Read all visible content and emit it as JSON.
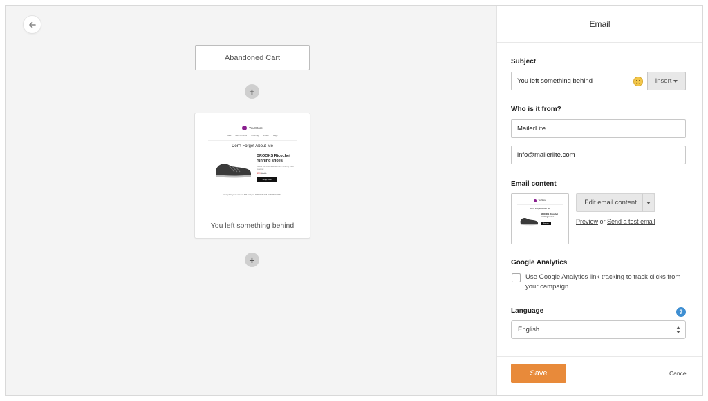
{
  "canvas": {
    "trigger_label": "Abandoned Cart",
    "email_card_label": "You left something behind",
    "preview": {
      "brand": "YourStore",
      "nav": [
        "Sale",
        "New Arrivals",
        "Clothing",
        "Shoes",
        "Bags"
      ],
      "heading": "Don't Forget About Me",
      "product_name": "BROOKS Ricochet running shoes",
      "product_desc": "Defeat the odds and Get OFF running shoe together.",
      "price_new": "$59",
      "price_old": "$110",
      "cta": "Shop now",
      "footer": "Complete your order in 48h and you 15% OFF YOUR PURCHASE!"
    }
  },
  "panel": {
    "title": "Email",
    "subject": {
      "label": "Subject",
      "value": "You left something behind",
      "insert_label": "Insert"
    },
    "from": {
      "label": "Who is it from?",
      "name_value": "MailerLite",
      "email_value": "info@mailerlite.com"
    },
    "content": {
      "label": "Email content",
      "edit_label": "Edit email content",
      "preview_link": "Preview",
      "or_text": " or ",
      "test_link": "Send a test email"
    },
    "analytics": {
      "label": "Google Analytics",
      "checkbox_text": "Use Google Analytics link tracking to track clicks from your campaign.",
      "checked": false
    },
    "language": {
      "label": "Language",
      "value": "English",
      "help": "?"
    },
    "save_label": "Save",
    "cancel_label": "Cancel"
  },
  "colors": {
    "accent": "#e88a3a",
    "help": "#3f8fd2",
    "brand_logo": "#8a1f8f"
  }
}
